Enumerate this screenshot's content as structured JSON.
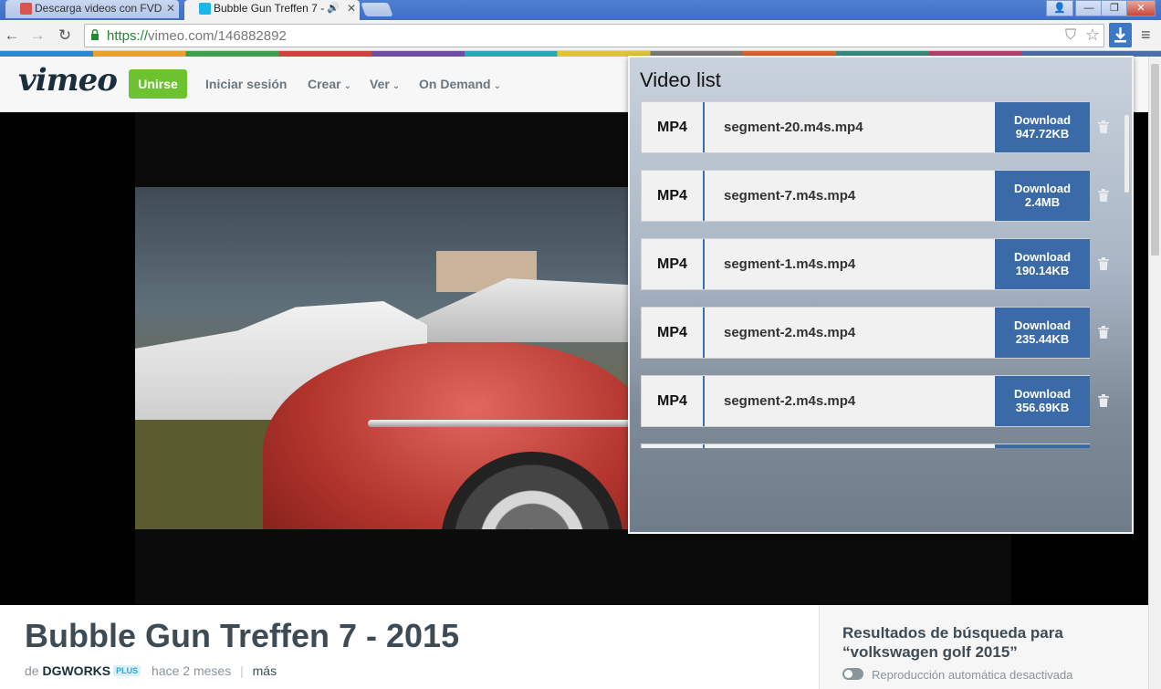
{
  "browser": {
    "tabs": [
      {
        "title": "Descarga videos con FVD",
        "favicon": "fvd-favicon",
        "favicon_color": "#d9534f",
        "active": false
      },
      {
        "title": "Bubble Gun Treffen 7 -",
        "favicon": "vimeo-favicon",
        "favicon_color": "#1ab7ea",
        "active": true,
        "audio_icon": "🔊"
      }
    ],
    "window_controls": {
      "user": "👤",
      "minimize": "—",
      "restore": "❐",
      "close": "✕"
    },
    "url_scheme": "https://",
    "url_rest": "vimeo.com/146882892",
    "nav": {
      "back": "←",
      "forward": "→",
      "reload": "↻"
    }
  },
  "vimeo": {
    "logo": "vimeo",
    "join_label": "Unirse",
    "nav": {
      "login": "Iniciar sesión",
      "create": "Crear",
      "watch": "Ver",
      "ondemand": "On Demand"
    },
    "chevron": "⌄",
    "video": {
      "title": "Bubble Gun Treffen 7 - 2015",
      "by": "de",
      "author": "DGWORKS",
      "badge": "PLUS",
      "age": "hace 2 meses",
      "separator": "|",
      "more": "más"
    },
    "sidebar": {
      "results_title": "Resultados de búsqueda para “volkswagen golf 2015”",
      "autoplay": "Reproducción automática desactivada"
    }
  },
  "popup": {
    "title": "Video list",
    "download_label": "Download",
    "items": [
      {
        "format": "MP4",
        "name": "segment-20.m4s.mp4",
        "size": "947.72KB"
      },
      {
        "format": "MP4",
        "name": "segment-7.m4s.mp4",
        "size": "2.4MB"
      },
      {
        "format": "MP4",
        "name": "segment-1.m4s.mp4",
        "size": "190.14KB"
      },
      {
        "format": "MP4",
        "name": "segment-2.m4s.mp4",
        "size": "235.44KB"
      },
      {
        "format": "MP4",
        "name": "segment-2.m4s.mp4",
        "size": "356.69KB"
      }
    ]
  },
  "colors": {
    "accent": "#3b6aa8",
    "vimeo_green": "#6cc32f"
  }
}
